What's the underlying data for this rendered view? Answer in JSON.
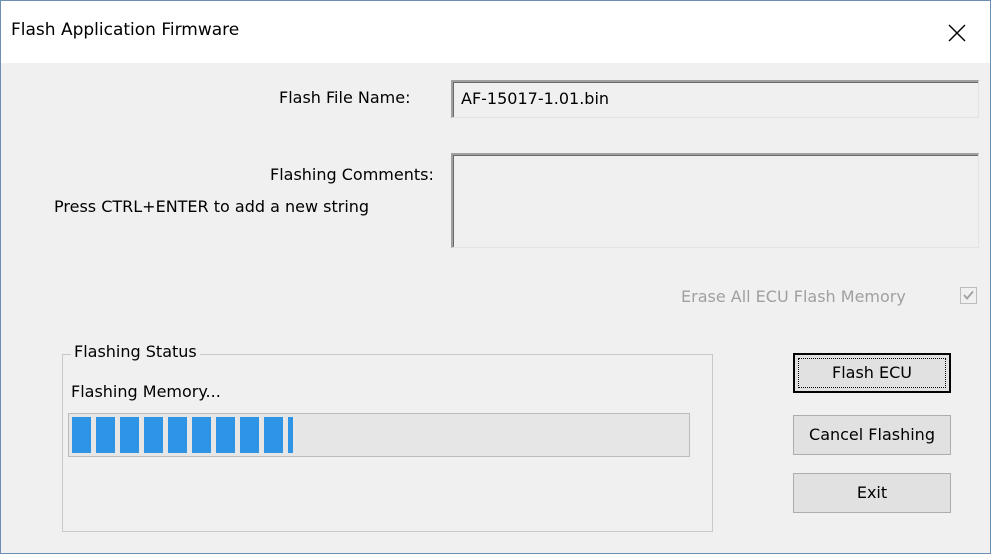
{
  "window": {
    "title": "Flash Application Firmware"
  },
  "form": {
    "file_name_label": "Flash File Name:",
    "file_name_value": "AF-15017-1.01.bin",
    "comments_label": "Flashing Comments:",
    "comments_hint": "Press CTRL+ENTER to add a new string",
    "comments_value": "",
    "erase_label": "Erase All ECU Flash Memory",
    "erase_checked": true,
    "erase_enabled": false
  },
  "status": {
    "group_label": "Flashing Status",
    "text": "Flashing Memory...",
    "progress_fraction": 0.36,
    "progress_color": "#2e94e6"
  },
  "buttons": {
    "flash_ecu": "Flash ECU",
    "cancel_flashing": "Cancel Flashing",
    "exit": "Exit"
  },
  "icons": {
    "close": "close-icon",
    "check": "checkmark-icon"
  }
}
